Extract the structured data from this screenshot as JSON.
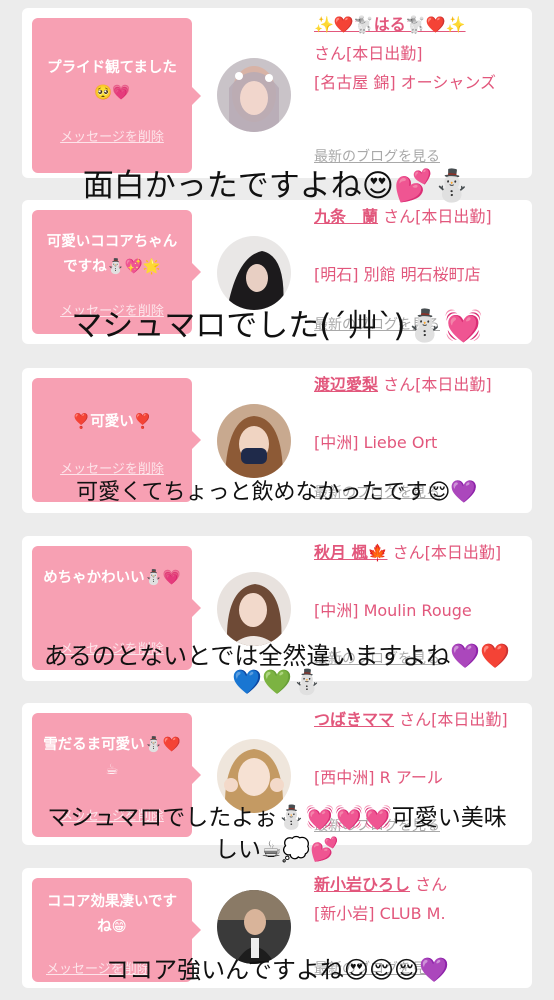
{
  "delete_label": "メッセージを削除",
  "blog_label": "最新のブログを見る",
  "cards": [
    {
      "message": "プライド観てました🥺💗",
      "name": "✨❤️🐩はる🐩❤️✨",
      "suffix": "さん[本日出勤]",
      "shop": "[名古屋 錦] オーシャンズ"
    },
    {
      "message": "可愛いココアちゃんですね⛄💖🌟",
      "name": "九条　蘭",
      "suffix": "さん[本日出勤]",
      "shop": "[明石] 別館 明石桜町店"
    },
    {
      "message": "❣️可愛い❣️",
      "name": "渡辺愛梨",
      "suffix": "さん[本日出勤]",
      "shop": "[中洲] Liebe Ort"
    },
    {
      "message": "めちゃかわいい⛄💗",
      "name": "秋月 楓🍁",
      "suffix": "さん[本日出勤]",
      "shop": "[中洲] Moulin Rouge"
    },
    {
      "message": "雪だるま可愛い⛄❤️☕",
      "name": "つばきママ",
      "suffix": "さん[本日出勤]",
      "shop": "[西中洲] R アール"
    },
    {
      "message": "ココア効果凄いですね😁",
      "name": "新小岩ひろし",
      "suffix": "さん",
      "shop": "[新小岩] CLUB M."
    }
  ],
  "captions": [
    "面白かったですよね😍💕⛄",
    "マシュマロでした(´艸`)⛄💓",
    "可愛くてちょっと飲めなかったです😌💜",
    "あるのとないとでは全然違いますよね💜❤️",
    "💙💚⛄",
    "マシュマロでしたよぉ⛄💓💓💓可愛い美味",
    "しい☕💭💕",
    "ココア強いんですよね😍😌😌💜"
  ]
}
